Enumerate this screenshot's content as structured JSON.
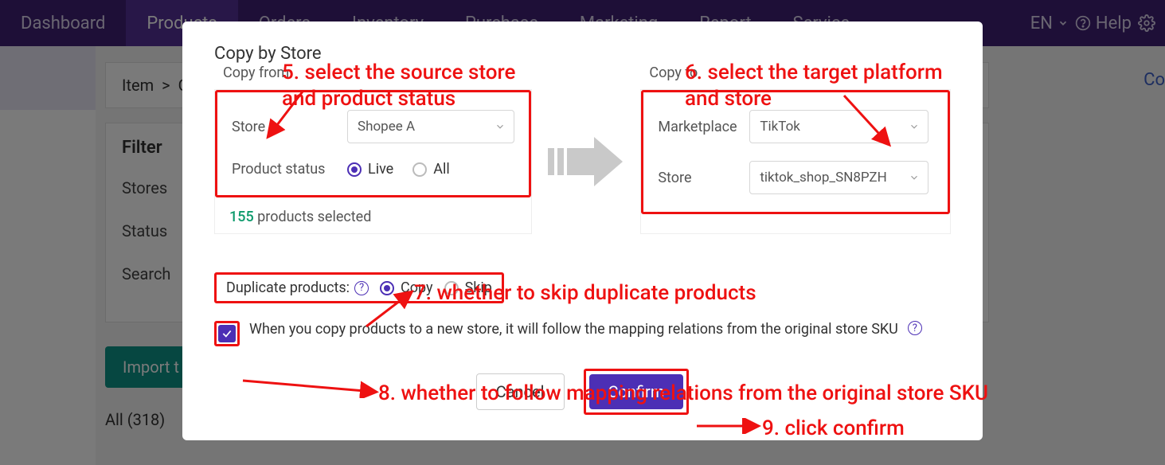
{
  "nav": {
    "items": [
      "Dashboard",
      "Products",
      "Orders",
      "Inventory",
      "Purchase",
      "Marketing",
      "Report",
      "Service"
    ],
    "active_index": 1,
    "lang": "EN",
    "help": "Help"
  },
  "breadcrumb": {
    "item": "Item",
    "sep": ">",
    "second": "C"
  },
  "crop_right_text": "Co",
  "filter": {
    "title": "Filter",
    "rows": [
      "Stores",
      "Status",
      "Search"
    ]
  },
  "import_btn": "Import t",
  "all_tab": "All (318)",
  "modal": {
    "title": "Copy by Store",
    "copy_from_label": "Copy from",
    "copy_to_label": "Copy to",
    "from": {
      "store_label": "Store",
      "store_value": "Shopee A",
      "status_label": "Product status",
      "status_options": {
        "live": "Live",
        "all": "All"
      },
      "status_selected": "live",
      "selected_count": "155",
      "selected_text": "products selected"
    },
    "to": {
      "marketplace_label": "Marketplace",
      "marketplace_value": "TikTok",
      "store_label": "Store",
      "store_value": "tiktok_shop_SN8PZH"
    },
    "duplicate": {
      "label": "Duplicate products:",
      "options": {
        "copy": "Copy",
        "skip": "Skip"
      },
      "selected": "copy"
    },
    "follow_mapping": {
      "checked": true,
      "text": "When you copy products to a new store, it will follow the mapping relations from the original store SKU"
    },
    "buttons": {
      "cancel": "Cancel",
      "confirm": "Confirm"
    }
  },
  "annotations": {
    "a5": "5. select the source store and product status",
    "a6": "6. select the target platform and store",
    "a7": "7. whether to skip duplicate products",
    "a8": "8. whether to follow mapping relations from the original store SKU",
    "a9": "9. click confirm"
  }
}
